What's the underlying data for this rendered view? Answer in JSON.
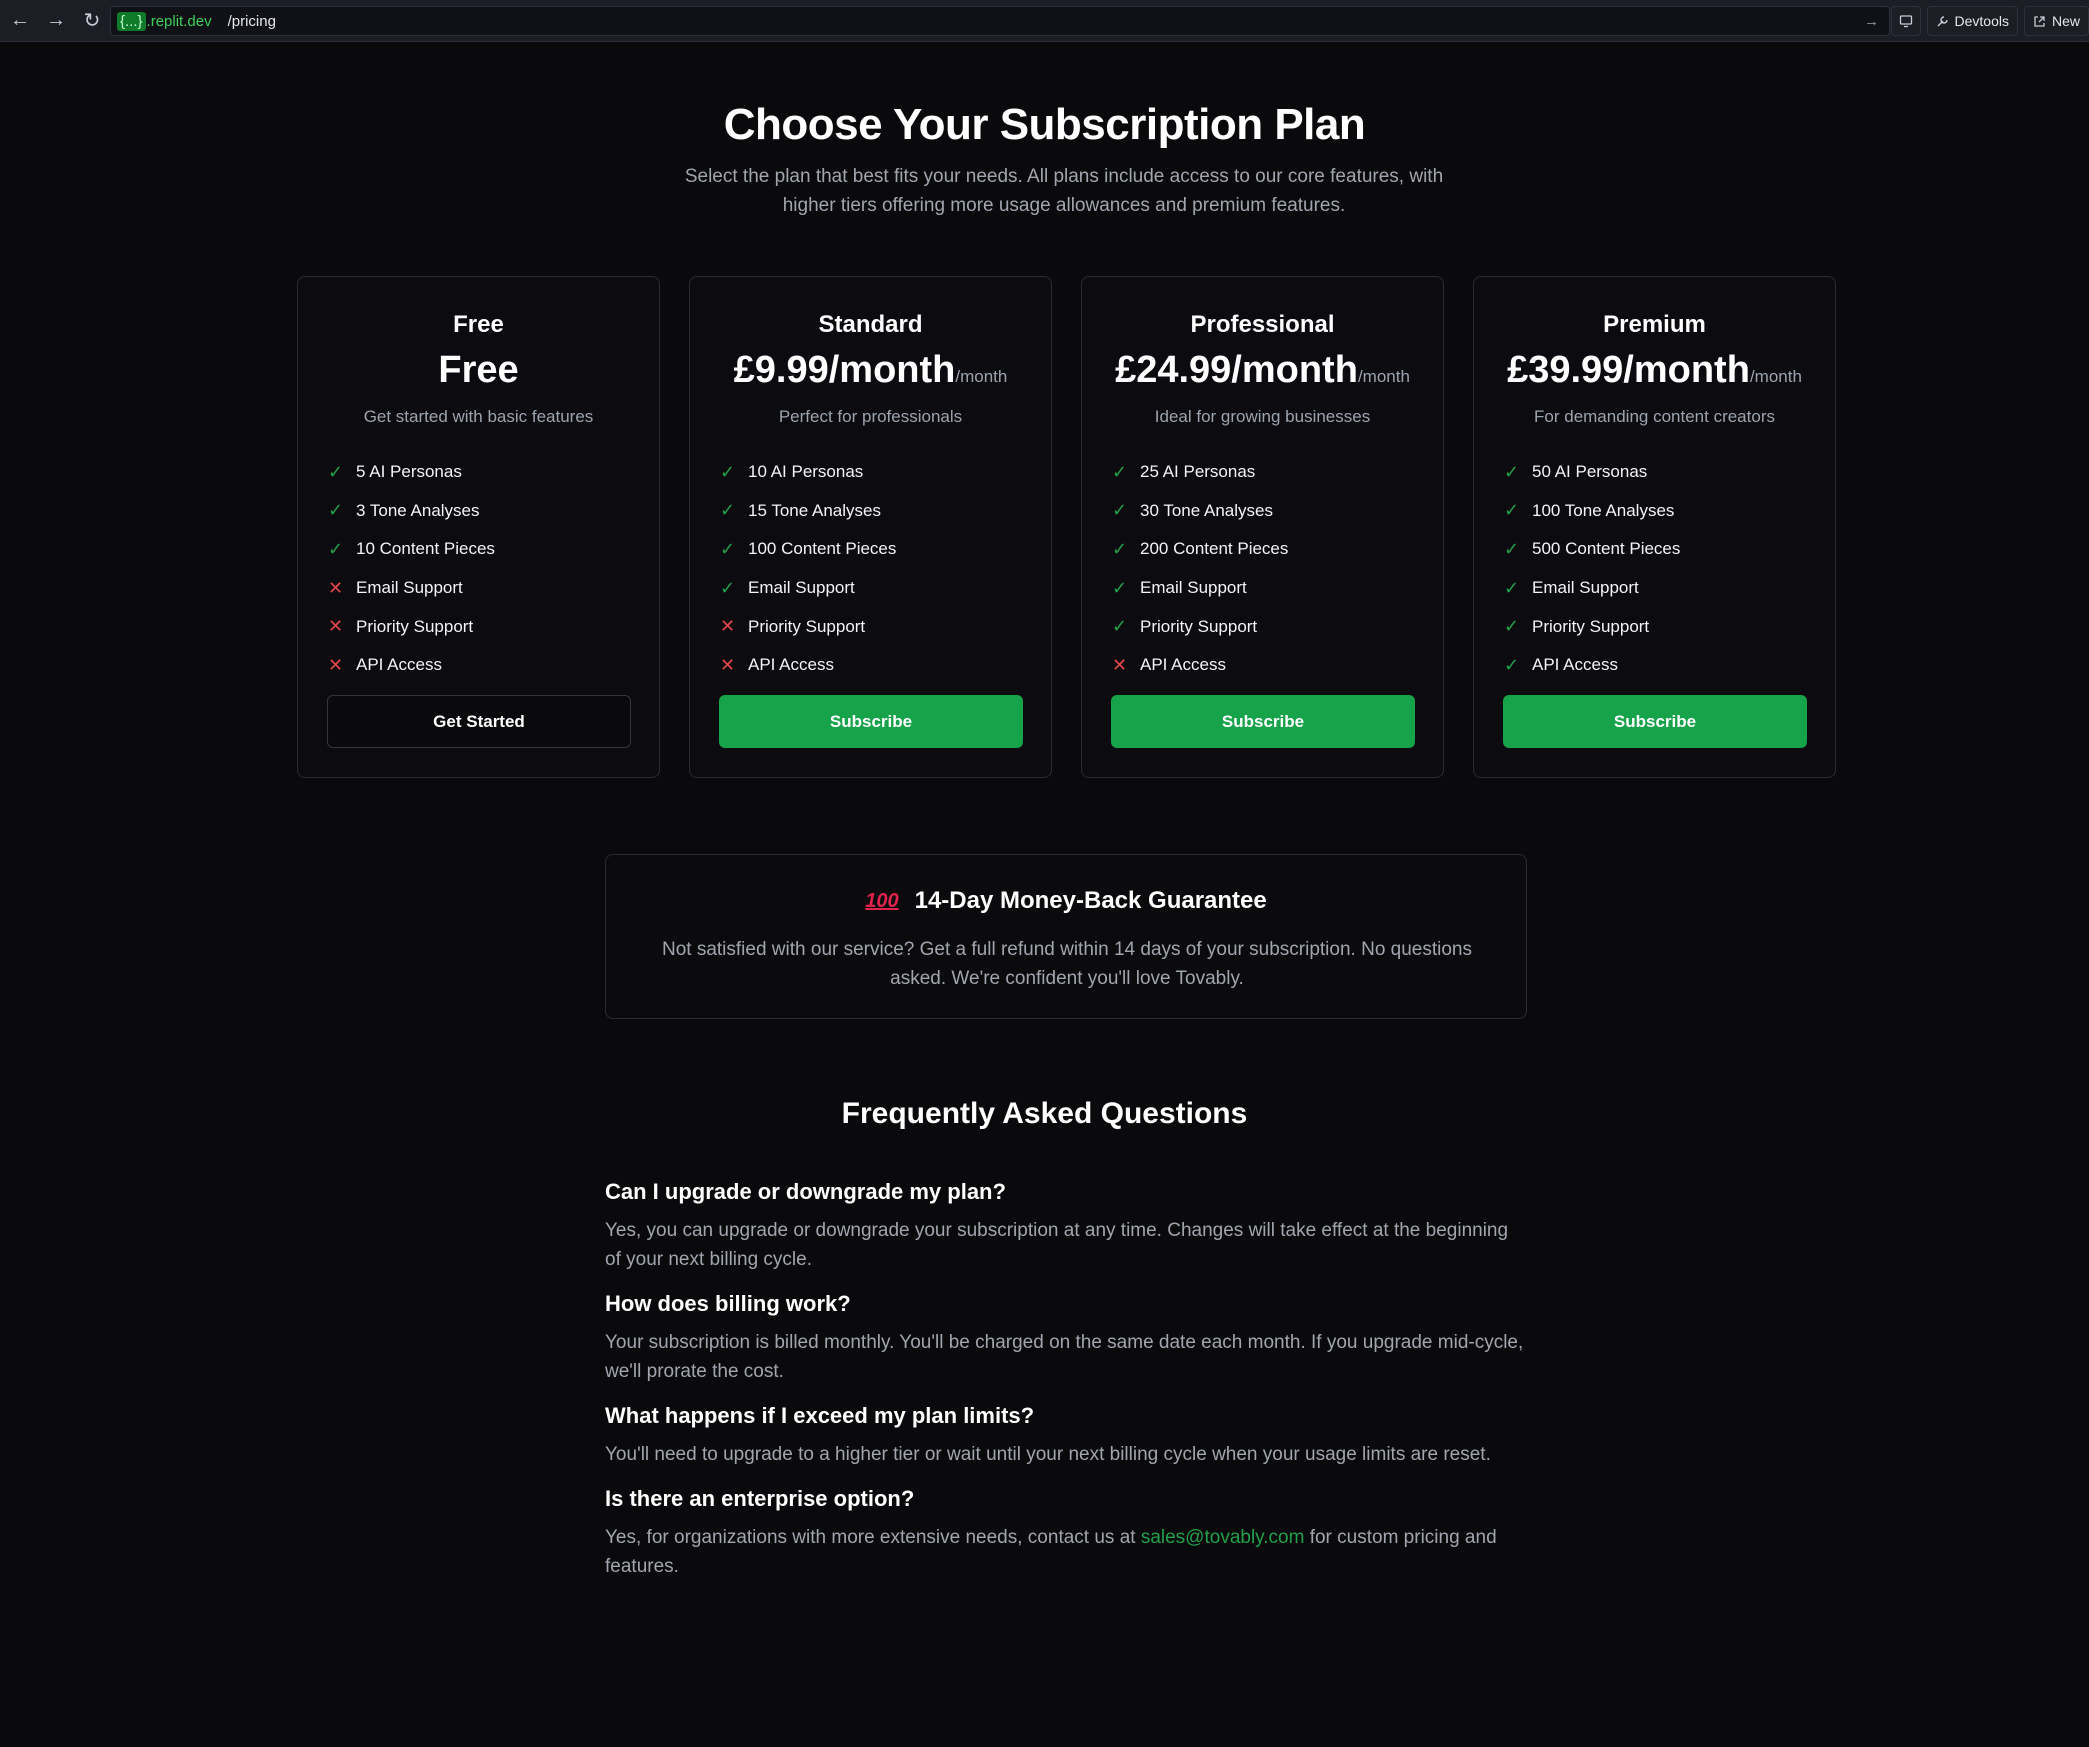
{
  "browser": {
    "back_icon": "←",
    "forward_icon": "→",
    "reload_icon": "↻",
    "url_host_brace": "{...}",
    "url_host": ".replit.dev",
    "url_path": "/pricing",
    "go_icon": "→",
    "devtools_label": "Devtools",
    "new_tab_label": "New"
  },
  "header": {
    "title": "Choose Your Subscription Plan",
    "subtitle": "Select the plan that best fits your needs. All plans include access to our core features, with higher tiers offering more usage allowances and premium features."
  },
  "plans": [
    {
      "name": "Free",
      "price": "Free",
      "per": "",
      "description": "Get started with basic features",
      "features": [
        {
          "label": "5 AI Personas",
          "included": true
        },
        {
          "label": "3 Tone Analyses",
          "included": true
        },
        {
          "label": "10 Content Pieces",
          "included": true
        },
        {
          "label": "Email Support",
          "included": false
        },
        {
          "label": "Priority Support",
          "included": false
        },
        {
          "label": "API Access",
          "included": false
        }
      ],
      "cta": "Get Started",
      "cta_style": "outline"
    },
    {
      "name": "Standard",
      "price": "£9.99/month",
      "per": "/month",
      "description": "Perfect for professionals",
      "features": [
        {
          "label": "10 AI Personas",
          "included": true
        },
        {
          "label": "15 Tone Analyses",
          "included": true
        },
        {
          "label": "100 Content Pieces",
          "included": true
        },
        {
          "label": "Email Support",
          "included": true
        },
        {
          "label": "Priority Support",
          "included": false
        },
        {
          "label": "API Access",
          "included": false
        }
      ],
      "cta": "Subscribe",
      "cta_style": "solid"
    },
    {
      "name": "Professional",
      "price": "£24.99/month",
      "per": "/month",
      "description": "Ideal for growing businesses",
      "features": [
        {
          "label": "25 AI Personas",
          "included": true
        },
        {
          "label": "30 Tone Analyses",
          "included": true
        },
        {
          "label": "200 Content Pieces",
          "included": true
        },
        {
          "label": "Email Support",
          "included": true
        },
        {
          "label": "Priority Support",
          "included": true
        },
        {
          "label": "API Access",
          "included": false
        }
      ],
      "cta": "Subscribe",
      "cta_style": "solid"
    },
    {
      "name": "Premium",
      "price": "£39.99/month",
      "per": "/month",
      "description": "For demanding content creators",
      "features": [
        {
          "label": "50 AI Personas",
          "included": true
        },
        {
          "label": "100 Tone Analyses",
          "included": true
        },
        {
          "label": "500 Content Pieces",
          "included": true
        },
        {
          "label": "Email Support",
          "included": true
        },
        {
          "label": "Priority Support",
          "included": true
        },
        {
          "label": "API Access",
          "included": true
        }
      ],
      "cta": "Subscribe",
      "cta_style": "solid"
    }
  ],
  "icons": {
    "check": "✓",
    "cross": "✕"
  },
  "guarantee": {
    "icon": "100",
    "title": "14-Day Money-Back Guarantee",
    "text": "Not satisfied with our service? Get a full refund within 14 days of your subscription. No questions asked. We're confident you'll love Tovably."
  },
  "faq": {
    "title": "Frequently Asked Questions",
    "items": [
      {
        "q": "Can I upgrade or downgrade my plan?",
        "a": "Yes, you can upgrade or downgrade your subscription at any time. Changes will take effect at the beginning of your next billing cycle."
      },
      {
        "q": "How does billing work?",
        "a": "Your subscription is billed monthly. You'll be charged on the same date each month. If you upgrade mid-cycle, we'll prorate the cost."
      },
      {
        "q": "What happens if I exceed my plan limits?",
        "a": "You'll need to upgrade to a higher tier or wait until your next billing cycle when your usage limits are reset."
      },
      {
        "q": "Is there an enterprise option?",
        "a_before": "Yes, for organizations with more extensive needs, contact us at ",
        "a_link": "sales@tovably.com",
        "a_after": " for custom pricing and features."
      }
    ]
  },
  "colors": {
    "accent": "#16a34a",
    "check": "#22a04a",
    "cross": "#e0474c",
    "background": "#0a0a0d"
  }
}
